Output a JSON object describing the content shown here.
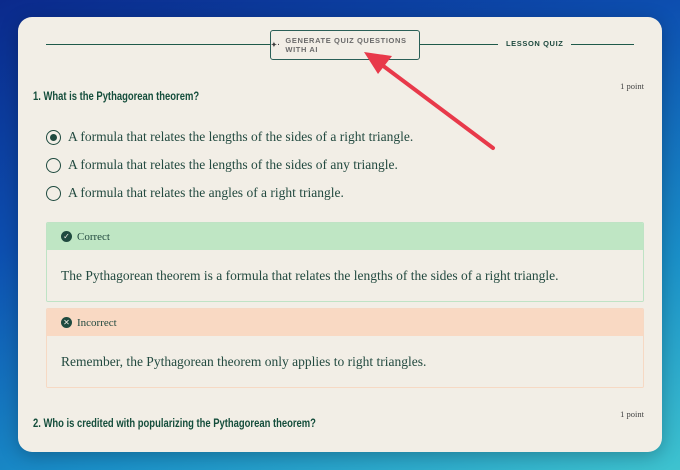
{
  "header": {
    "generate_button_label": "GENERATE QUIZ QUESTIONS WITH AI",
    "lesson_label": "LESSON QUIZ"
  },
  "questions": [
    {
      "title": "1.  What is the Pythagorean theorem?",
      "points": "1 point",
      "options": [
        {
          "label": "A formula that relates the lengths of the sides of a right triangle.",
          "selected": true
        },
        {
          "label": "A formula that relates the lengths of the sides of any triangle.",
          "selected": false
        },
        {
          "label": "A formula that relates the angles of a right triangle.",
          "selected": false
        }
      ],
      "feedback": [
        {
          "status": "Correct",
          "text": "The Pythagorean theorem is a formula that relates the lengths of the sides of a right triangle.",
          "icon": "check-icon"
        },
        {
          "status": "Incorrect",
          "text": "Remember, the Pythagorean theorem only applies to right triangles.",
          "icon": "x-icon"
        }
      ]
    },
    {
      "title": "2.  Who is credited with popularizing the Pythagorean theorem?",
      "points": "1 point"
    }
  ],
  "colors": {
    "accent_dark_green": "#1f4a3f",
    "correct_bg": "#bfe6c4",
    "incorrect_bg": "#f9d9c3",
    "annotation_arrow": "#e8394a"
  }
}
